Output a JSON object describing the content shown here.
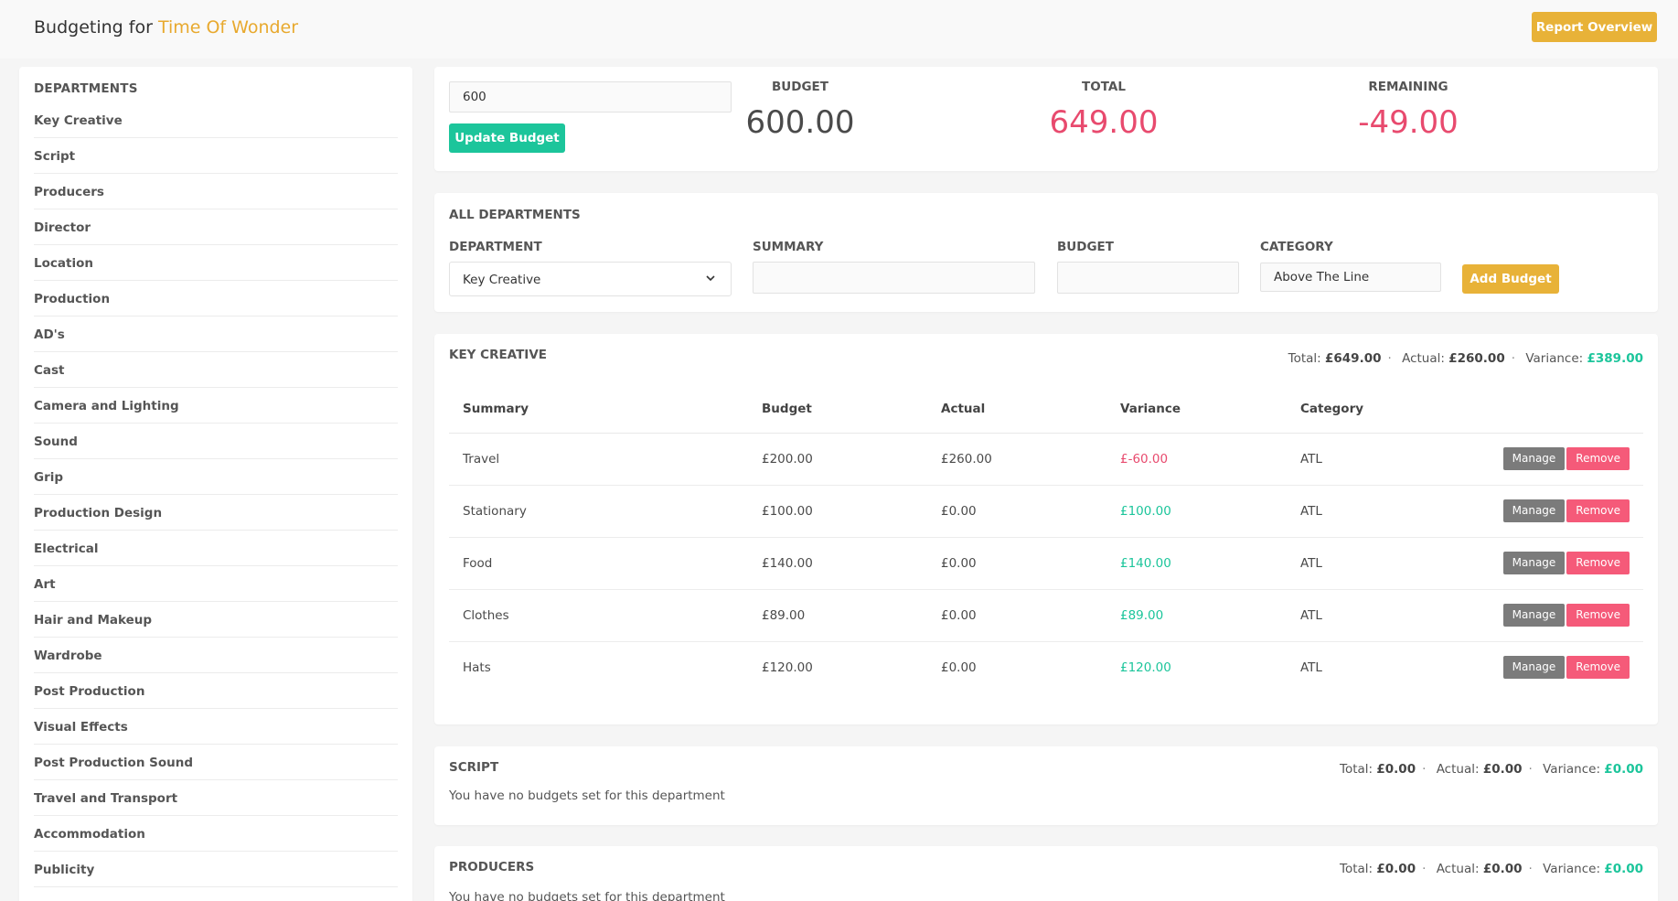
{
  "header": {
    "title_prefix": "Budgeting for",
    "project_name": "Time Of Wonder",
    "report_button": "Report Overview"
  },
  "sidebar": {
    "heading": "DEPARTMENTS",
    "items": [
      "Key Creative",
      "Script",
      "Producers",
      "Director",
      "Location",
      "Production",
      "AD's",
      "Cast",
      "Camera and Lighting",
      "Sound",
      "Grip",
      "Production Design",
      "Electrical",
      "Art",
      "Hair and Makeup",
      "Wardrobe",
      "Post Production",
      "Visual Effects",
      "Post Production Sound",
      "Travel and Transport",
      "Accommodation",
      "Publicity"
    ]
  },
  "summary": {
    "budget_input_value": "600",
    "update_button": "Update Budget",
    "budget_label": "BUDGET",
    "budget_value": "600.00",
    "total_label": "TOTAL",
    "total_value": "649.00",
    "remaining_label": "REMAINING",
    "remaining_value": "-49.00"
  },
  "add_form": {
    "title": "ALL DEPARTMENTS",
    "department_label": "DEPARTMENT",
    "department_value": "Key Creative",
    "summary_label": "SUMMARY",
    "summary_value": "",
    "budget_label": "BUDGET",
    "budget_value": "",
    "category_label": "CATEGORY",
    "category_value": "Above The Line",
    "add_button": "Add Budget"
  },
  "departments": [
    {
      "name": "KEY CREATIVE",
      "total_label": "Total:",
      "total": "£649.00",
      "actual_label": "Actual:",
      "actual": "£260.00",
      "variance_label": "Variance:",
      "variance": "£389.00",
      "columns": [
        "Summary",
        "Budget",
        "Actual",
        "Variance",
        "Category"
      ],
      "rows": [
        {
          "summary": "Travel",
          "budget": "£200.00",
          "actual": "£260.00",
          "variance": "£-60.00",
          "variance_status": "neg",
          "category": "ATL"
        },
        {
          "summary": "Stationary",
          "budget": "£100.00",
          "actual": "£0.00",
          "variance": "£100.00",
          "variance_status": "pos",
          "category": "ATL"
        },
        {
          "summary": "Food",
          "budget": "£140.00",
          "actual": "£0.00",
          "variance": "£140.00",
          "variance_status": "pos",
          "category": "ATL"
        },
        {
          "summary": "Clothes",
          "budget": "£89.00",
          "actual": "£0.00",
          "variance": "£89.00",
          "variance_status": "pos",
          "category": "ATL"
        },
        {
          "summary": "Hats",
          "budget": "£120.00",
          "actual": "£0.00",
          "variance": "£120.00",
          "variance_status": "pos",
          "category": "ATL"
        }
      ],
      "manage_label": "Manage",
      "remove_label": "Remove"
    },
    {
      "name": "SCRIPT",
      "total_label": "Total:",
      "total": "£0.00",
      "actual_label": "Actual:",
      "actual": "£0.00",
      "variance_label": "Variance:",
      "variance": "£0.00",
      "empty_message": "You have no budgets set for this department"
    },
    {
      "name": "PRODUCERS",
      "total_label": "Total:",
      "total": "£0.00",
      "actual_label": "Actual:",
      "actual": "£0.00",
      "variance_label": "Variance:",
      "variance": "£0.00",
      "empty_message": "You have no budgets set for this department"
    }
  ],
  "colors": {
    "accent": "#e8b238",
    "positive": "#1cc59b",
    "negative": "#e84a6e",
    "remove": "#f55a79",
    "manage": "#7b7b7b"
  },
  "icons": {
    "select_chevron": "chevron-down-icon"
  }
}
